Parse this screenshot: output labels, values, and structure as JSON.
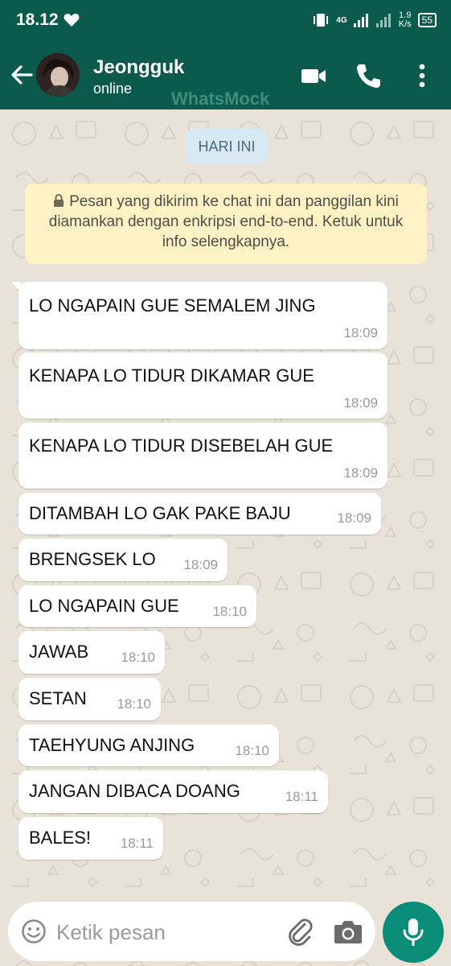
{
  "status_bar": {
    "time": "18.12",
    "network": "4G",
    "speed_value": "1.9",
    "speed_unit": "K/s",
    "battery": "55"
  },
  "header": {
    "contact_name": "Jeongguk",
    "status": "online",
    "watermark": "WhatsMock"
  },
  "chat": {
    "date_label": "HARI INI",
    "encryption_notice": "Pesan yang dikirim ke chat ini dan panggilan kini diamankan dengan enkripsi end-to-end. Ketuk untuk info selengkapnya.",
    "messages": [
      {
        "text": "LO NGAPAIN GUE SEMALEM JING",
        "time": "18:09"
      },
      {
        "text": "KENAPA LO TIDUR DIKAMAR GUE",
        "time": "18:09"
      },
      {
        "text": "KENAPA LO TIDUR DISEBELAH GUE",
        "time": "18:09"
      },
      {
        "text": "DITAMBAH LO GAK PAKE BAJU",
        "time": "18:09"
      },
      {
        "text": "BRENGSEK LO",
        "time": "18:09"
      },
      {
        "text": "LO NGAPAIN GUE",
        "time": "18:10"
      },
      {
        "text": "JAWAB",
        "time": "18:10"
      },
      {
        "text": "SETAN",
        "time": "18:10"
      },
      {
        "text": "TAEHYUNG ANJING",
        "time": "18:10"
      },
      {
        "text": "JANGAN DIBACA DOANG",
        "time": "18:11"
      },
      {
        "text": "BALES!",
        "time": "18:11"
      }
    ]
  },
  "input": {
    "placeholder": "Ketik pesan",
    "value": ""
  },
  "colors": {
    "header": "#0a5b4c",
    "mic_button": "#0a8d78",
    "chat_background": "#e9e2d8",
    "date_pill": "#d7eaf4",
    "notice": "#fdf2c3"
  },
  "icons": {
    "status_left": "heart-icon",
    "header": [
      "back-arrow-icon",
      "video-call-icon",
      "phone-icon",
      "more-vert-icon"
    ],
    "input": [
      "emoji-icon",
      "paperclip-icon",
      "camera-icon",
      "mic-icon"
    ]
  }
}
